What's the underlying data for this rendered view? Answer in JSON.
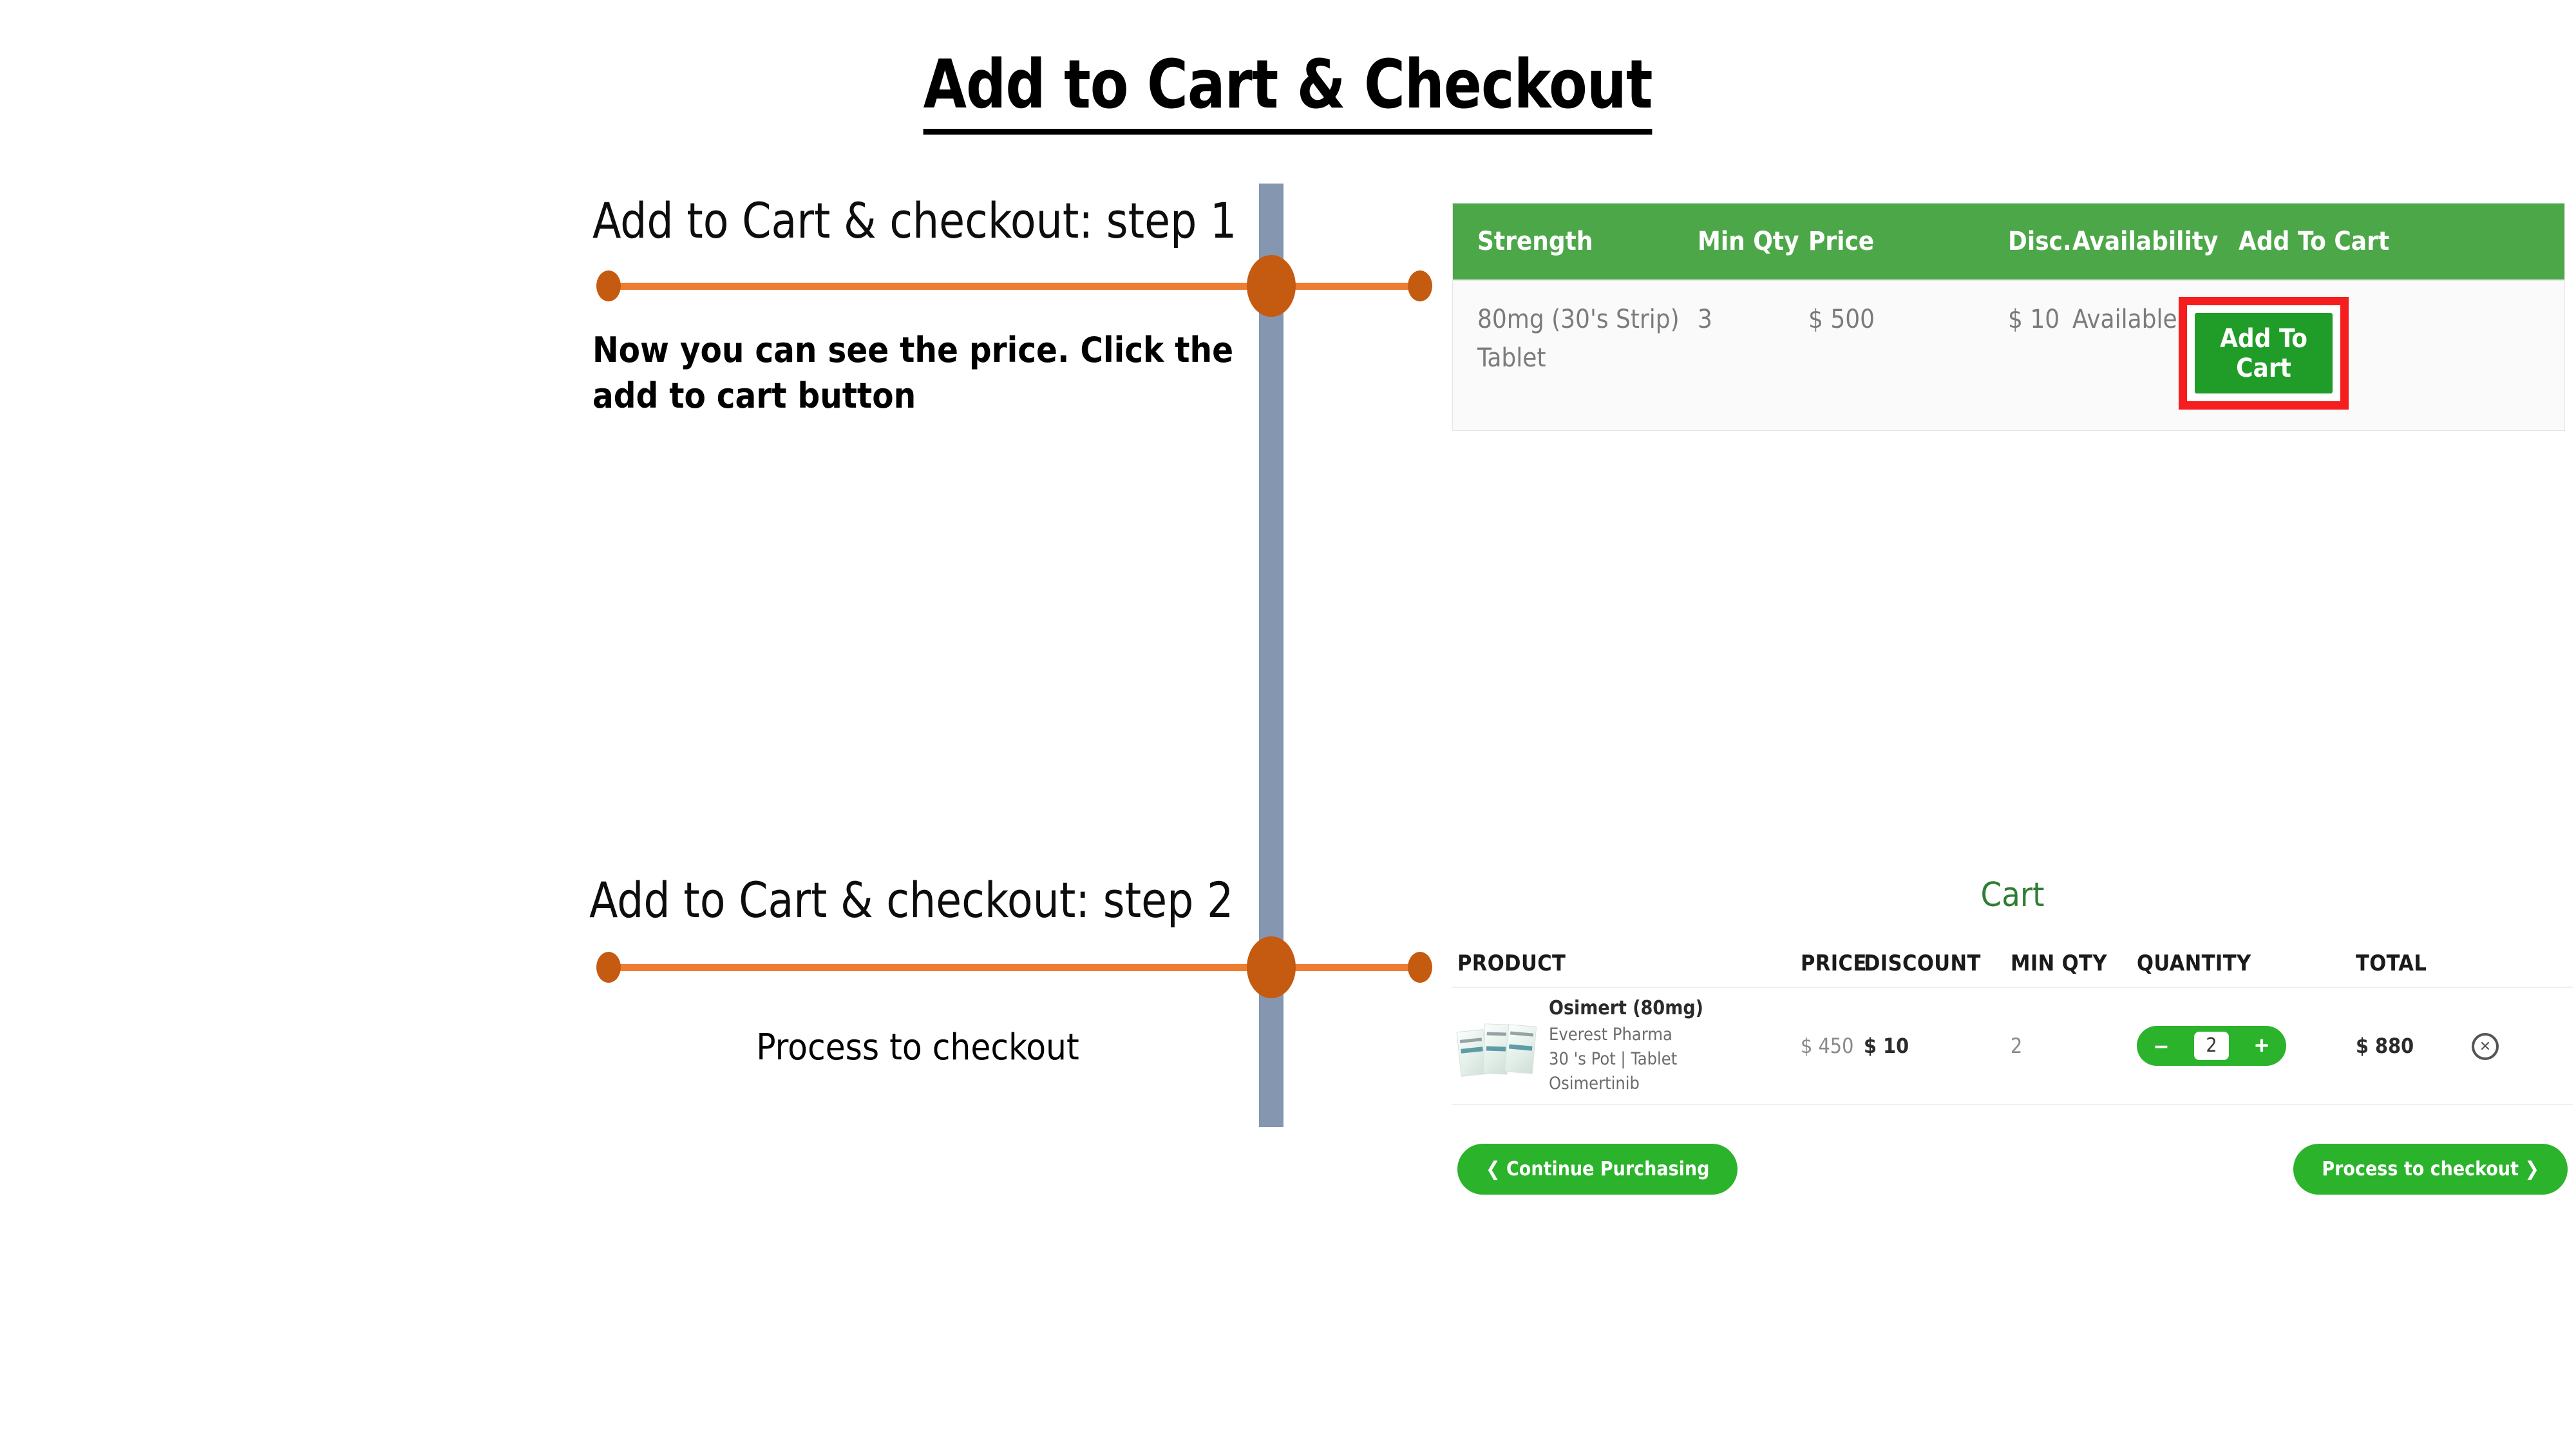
{
  "slide": {
    "title": "Add to Cart & Checkout"
  },
  "steps": [
    {
      "heading": "Add to Cart & checkout: step 1",
      "body": "Now you can see the price. Click the add to cart button"
    },
    {
      "heading": "Add to Cart & checkout: step 2",
      "body": "Process to checkout"
    }
  ],
  "product_table": {
    "columns": [
      "Strength",
      "Min Qty",
      "Price",
      "Disc.",
      "Availability",
      "Add To Cart"
    ],
    "row": {
      "strength": "80mg (30's Strip) Tablet",
      "min_qty": "3",
      "price": "$ 500",
      "disc": "$ 10",
      "availability": "Available",
      "add_to_cart_label": "Add To Cart"
    },
    "header_color": "#4CA748",
    "button_color": "#1F9D28",
    "highlight_color": "#F51D1D"
  },
  "cart": {
    "title": "Cart",
    "columns": [
      "PRODUCT",
      "PRICE",
      "DISCOUNT",
      "MIN QTY",
      "QUANTITY",
      "TOTAL"
    ],
    "item": {
      "name": "Osimert (80mg)",
      "manufacturer": "Everest Pharma",
      "pack": "30 's Pot | Tablet",
      "molecule": "Osimertinib",
      "price": "$ 450",
      "discount": "$ 10",
      "min_qty": "2",
      "quantity": "2",
      "decrement_label": "–",
      "increment_label": "+",
      "total": "$ 880",
      "remove_label": "✕"
    },
    "footer": {
      "continue_label": "❮ Continue Purchasing",
      "checkout_label": "Process to checkout ❯"
    },
    "accent_color": "#2BB32B",
    "title_color": "#2E7D32"
  },
  "timeline": {
    "bar_color": "#8496B0",
    "line_color": "#ED7D31",
    "dot_color": "#C55A11"
  }
}
